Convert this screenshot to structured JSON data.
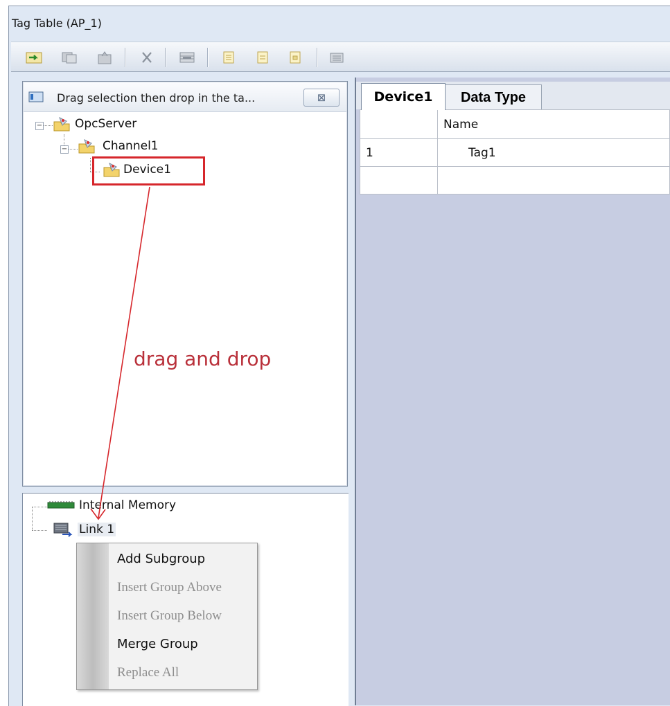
{
  "window": {
    "title": "Tag Table (AP_1)"
  },
  "toolbar": {
    "buttons": [
      "import-icon",
      "copy-icon",
      "paste-icon",
      "delete-icon",
      "grid-icon",
      "document-add-icon",
      "document-icon",
      "document-copy-icon",
      "keyboard-icon"
    ]
  },
  "source_panel": {
    "header": "Drag selection then drop in the ta...",
    "close_glyph": "⊠",
    "tree": {
      "root": "OpcServer",
      "channel": "Channel1",
      "device": "Device1"
    }
  },
  "annotation": {
    "label": "drag and drop",
    "color": "#d6262b"
  },
  "target_panel": {
    "items": [
      "Internal Memory",
      "Link 1"
    ]
  },
  "context_menu": {
    "items": [
      {
        "label": "Add Subgroup",
        "enabled": true
      },
      {
        "label": "Insert Group Above",
        "enabled": false
      },
      {
        "label": "Insert Group Below",
        "enabled": false
      },
      {
        "label": "Merge Group",
        "enabled": true
      },
      {
        "label": "Replace All",
        "enabled": false
      }
    ]
  },
  "tabs": {
    "active": "Device1",
    "inactive": "Data Type"
  },
  "table": {
    "columns": [
      "",
      "Name"
    ],
    "rows": [
      {
        "num": "1",
        "name": "Tag1"
      },
      {
        "num": "",
        "name": ""
      }
    ]
  }
}
